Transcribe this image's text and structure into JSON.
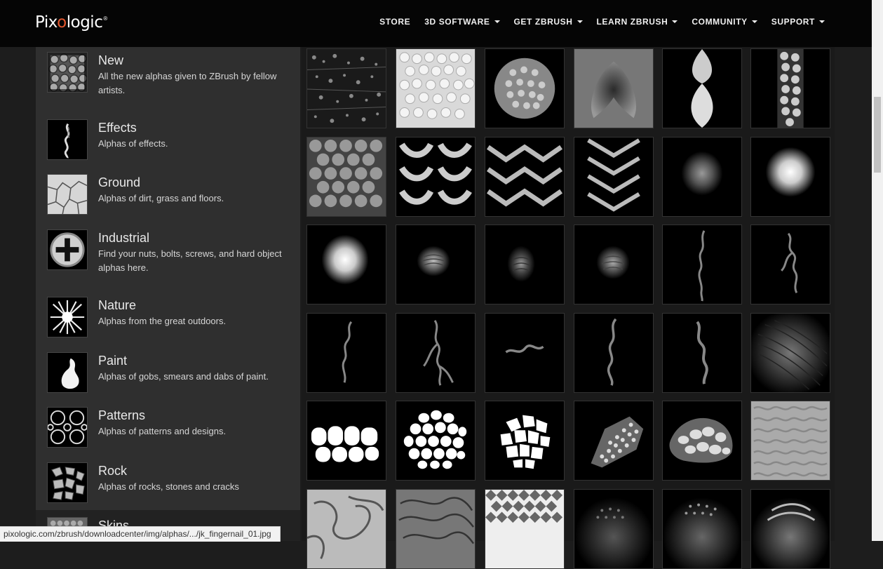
{
  "logo": {
    "pre": "Pix",
    "o": "o",
    "post": "logic",
    "tm": "®"
  },
  "nav": [
    {
      "label": "STORE",
      "dropdown": false
    },
    {
      "label": "3D SOFTWARE",
      "dropdown": true
    },
    {
      "label": "GET ZBRUSH",
      "dropdown": true
    },
    {
      "label": "LEARN ZBRUSH",
      "dropdown": true
    },
    {
      "label": "COMMUNITY",
      "dropdown": true
    },
    {
      "label": "SUPPORT",
      "dropdown": true
    }
  ],
  "categories": [
    {
      "title": "New",
      "desc": "All the new alphas given to ZBrush by fellow artists."
    },
    {
      "title": "Effects",
      "desc": "Alphas of effects."
    },
    {
      "title": "Ground",
      "desc": "Alphas of dirt, grass and floors."
    },
    {
      "title": "Industrial",
      "desc": "Find your nuts, bolts, screws, and hard object alphas here."
    },
    {
      "title": "Nature",
      "desc": "Alphas from the great outdoors."
    },
    {
      "title": "Paint",
      "desc": "Alphas of gobs, smears and dabs of paint."
    },
    {
      "title": "Patterns",
      "desc": "Alphas of patterns and designs."
    },
    {
      "title": "Rock",
      "desc": "Alphas of rocks, stones and cracks"
    },
    {
      "title": "Skins",
      "desc": ""
    }
  ],
  "status_url": "pixologic.com/zbrush/downloadcenter/img/alphas/.../jk_fingernail_01.jpg",
  "colors": {
    "accent": "#e4572e",
    "topbar": "#050505",
    "sidebar": "#2f2f2f"
  }
}
